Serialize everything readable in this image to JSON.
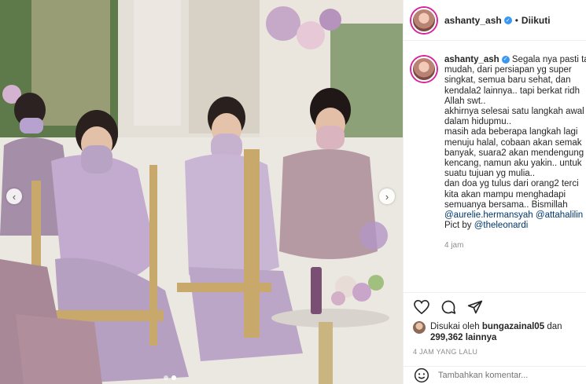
{
  "post": {
    "username": "ashanty_ash",
    "separator": "•",
    "follow_status": "Diikuti",
    "caption": {
      "username": "ashanty_ash",
      "lines": [
        "Segala nya pasti ta",
        "mudah, dari persiapan yg super",
        "singkat, semua baru sehat, dan",
        "kendala2 lainnya.. tapi berkat ridh",
        "Allah swt..",
        "akhirnya selesai satu langkah awal",
        "dalam hidupmu..",
        "masih ada beberapa langkah lagi",
        "menuju halal, cobaan akan semak",
        "banyak, suara2 akan mendengung",
        "kencang, namun aku yakin.. untuk",
        "suatu tujuan yg mulia..",
        "dan doa yg tulus dari orang2 terci",
        "kita akan mampu menghadapi",
        "semuanya bersama.. Bismillah"
      ],
      "mentions_line": [
        "@aurelie.hermansyah",
        "@attahalilin"
      ],
      "credit_prefix": "Pict by",
      "credit_mention": "@theleonardi",
      "time": "4 jam"
    },
    "likes": {
      "prefix": "Disukai oleh",
      "liker": "bungazainal05",
      "and": "dan",
      "count_text": "299,362 lainnya"
    },
    "date": "4 JAM YANG LALU",
    "comment_placeholder": "Tambahkan komentar..."
  },
  "icons": {
    "verified": "verified-badge-icon",
    "like": "heart-icon",
    "comment": "comment-bubble-icon",
    "share": "paper-plane-icon",
    "emoji": "smiley-icon",
    "prev": "chevron-left-icon",
    "next": "chevron-right-icon"
  },
  "colors": {
    "mention": "#00376b",
    "verified": "#3897f0",
    "muted": "#8e8e8e",
    "lavender_dress": "#b9a3c4"
  },
  "carousel": {
    "slides": 2,
    "active": 1
  }
}
